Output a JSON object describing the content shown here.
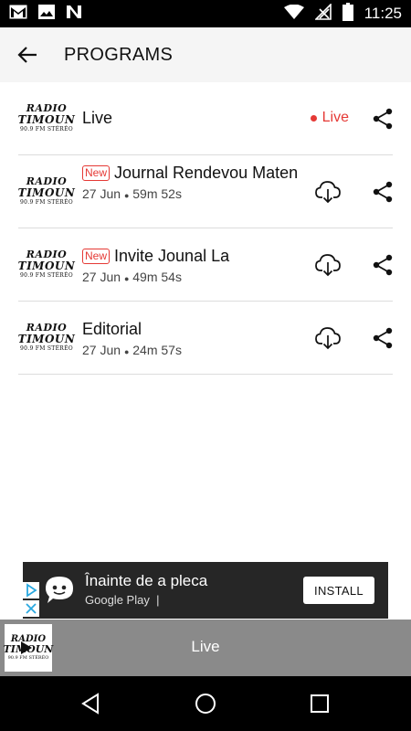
{
  "status_bar": {
    "time": "11:25",
    "left_icons": [
      "gmail-icon",
      "image-icon",
      "n-app-icon"
    ],
    "right_icons": [
      "wifi-icon",
      "no-signal-icon",
      "battery-icon"
    ]
  },
  "app_bar": {
    "title": "PROGRAMS"
  },
  "logo": {
    "line1": "RADIO",
    "line2": "TIMOUN",
    "line3": "90.9 FM STÉRÉO"
  },
  "programs": [
    {
      "title": "Live",
      "is_new": false,
      "date": "",
      "duration": "",
      "status": "Live",
      "downloadable": false
    },
    {
      "title": "Journal Rendevou Maten",
      "is_new": true,
      "date": "27 Jun",
      "duration": "59m 52s",
      "status": "",
      "downloadable": true
    },
    {
      "title": "Invite Jounal La",
      "is_new": true,
      "date": "27 Jun",
      "duration": "49m 54s",
      "status": "",
      "downloadable": true
    },
    {
      "title": "Editorial",
      "is_new": false,
      "date": "27 Jun",
      "duration": "24m 57s",
      "status": "",
      "downloadable": true
    }
  ],
  "badge_new": "New",
  "meta_separator": "●",
  "ad": {
    "title": "Înainte de a pleca",
    "subtitle": "Google Play",
    "subtitle_divider": "|",
    "install_label": "INSTALL"
  },
  "mini_player": {
    "title": "Live"
  },
  "colors": {
    "accent_red": "#e53935",
    "status_bar": "#000000",
    "app_bar": "#f5f5f5",
    "mini_player": "#8a8a8a",
    "ad_background": "#262626"
  }
}
